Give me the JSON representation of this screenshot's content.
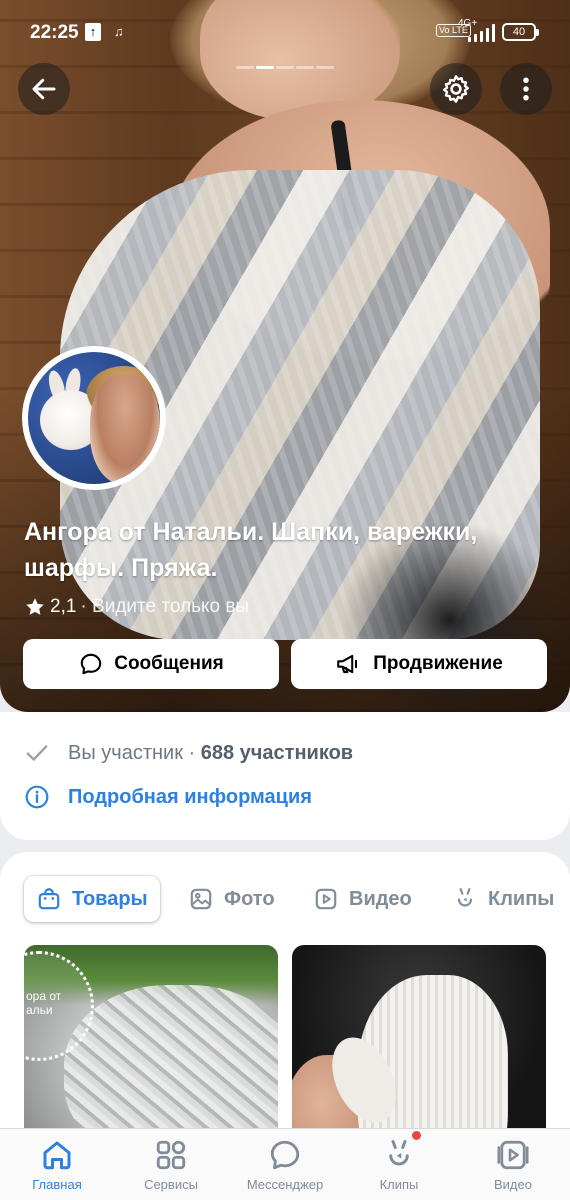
{
  "status_bar": {
    "time": "22:25",
    "network": "4G+",
    "volte": "Vo LTE",
    "battery": "40"
  },
  "group": {
    "name": "Ангора от Натальи. Шапки, варежки, шарфы. Пряжа.",
    "rating": "2,1",
    "visibility": "· Видите только вы"
  },
  "actions": {
    "messages_label": "Сообщения",
    "promote_label": "Продвижение"
  },
  "info": {
    "members_prefix": "Вы участник ·",
    "members_count": "688",
    "members_suffix": "участников",
    "details_label": "Подробная информация"
  },
  "tabs": [
    {
      "label": "Товары",
      "icon": "bag-icon",
      "active": true
    },
    {
      "label": "Фото",
      "icon": "photo-icon",
      "active": false
    },
    {
      "label": "Видео",
      "icon": "video-icon",
      "active": false
    },
    {
      "label": "Клипы",
      "icon": "clips-icon",
      "active": false
    }
  ],
  "products": [
    {
      "stamp_text": "ора от\nальи"
    },
    {}
  ],
  "bottom_nav": [
    {
      "label": "Главная",
      "icon": "home-icon",
      "active": true
    },
    {
      "label": "Сервисы",
      "icon": "services-icon",
      "active": false
    },
    {
      "label": "Мессенджер",
      "icon": "messenger-icon",
      "active": false
    },
    {
      "label": "Клипы",
      "icon": "clips-icon",
      "active": false,
      "badge": true
    },
    {
      "label": "Видео",
      "icon": "video-icon",
      "active": false
    }
  ],
  "colors": {
    "accent": "#2d81e0",
    "secondary_text": "#818c99",
    "badge": "#e64646"
  }
}
